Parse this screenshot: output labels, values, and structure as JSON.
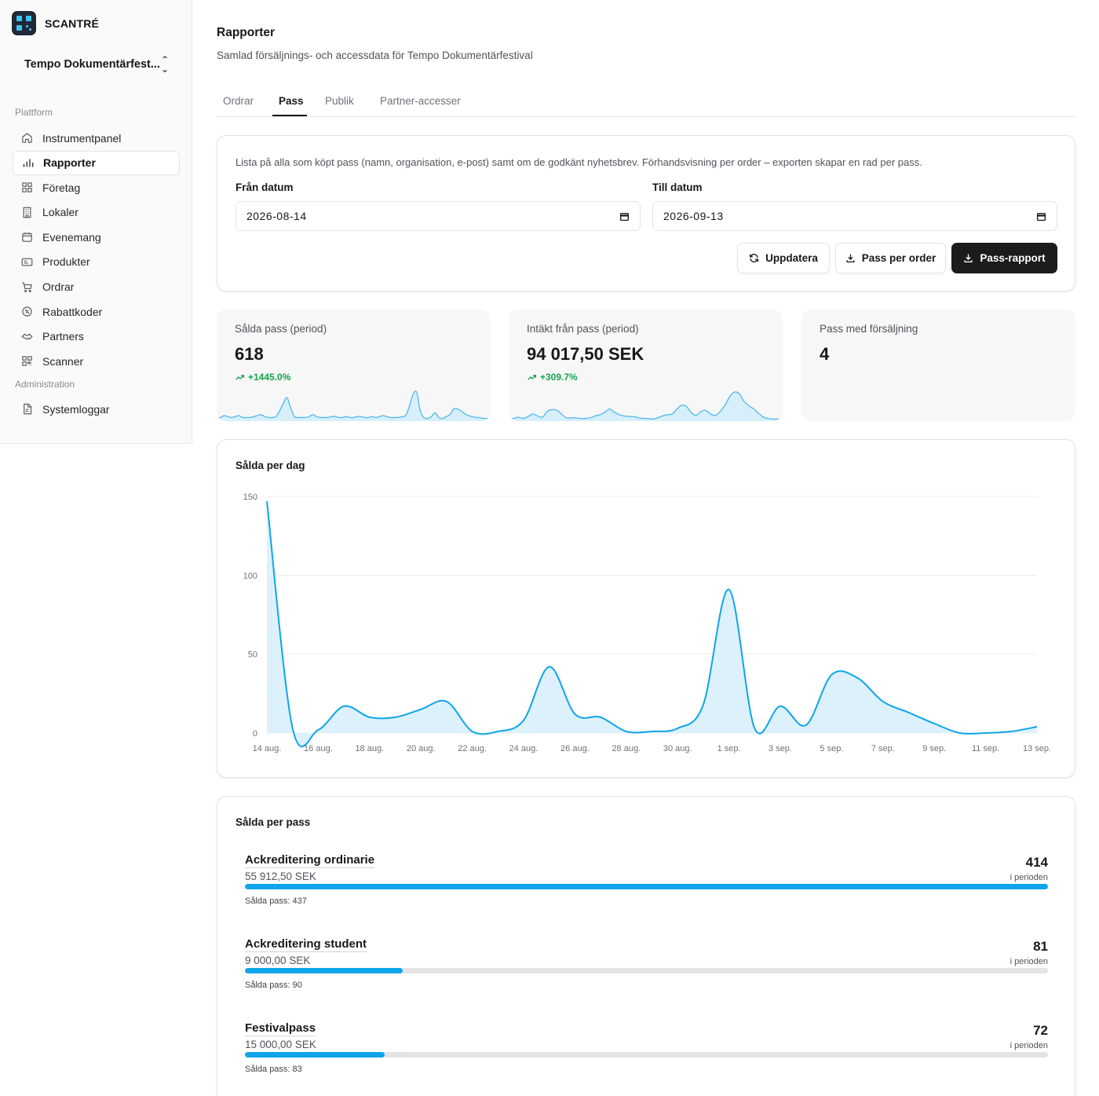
{
  "brand": {
    "name": "SCANTRÉ"
  },
  "org": {
    "name": "Tempo Dokumentärfest...",
    "chevron_icon": "chevrons-up-down-icon"
  },
  "sidebar": {
    "section_platform": "Plattform",
    "section_admin": "Administration",
    "items": [
      {
        "label": "Instrumentpanel",
        "icon": "home-icon"
      },
      {
        "label": "Rapporter",
        "icon": "bar-chart-icon",
        "active": true
      },
      {
        "label": "Företag",
        "icon": "grid-icon"
      },
      {
        "label": "Lokaler",
        "icon": "building-icon"
      },
      {
        "label": "Evenemang",
        "icon": "calendar-icon"
      },
      {
        "label": "Produkter",
        "icon": "ticket-icon"
      },
      {
        "label": "Ordrar",
        "icon": "cart-icon"
      },
      {
        "label": "Rabattkoder",
        "icon": "badge-percent-icon"
      },
      {
        "label": "Partners",
        "icon": "handshake-icon"
      },
      {
        "label": "Scanner",
        "icon": "qr-code-icon"
      }
    ],
    "admin_items": [
      {
        "label": "Systemloggar",
        "icon": "file-icon"
      }
    ]
  },
  "header": {
    "title": "Rapporter",
    "subtitle": "Samlad försäljnings- och accessdata för Tempo Dokumentärfestival"
  },
  "tabs": [
    {
      "label": "Ordrar"
    },
    {
      "label": "Pass",
      "active": true
    },
    {
      "label": "Publik"
    },
    {
      "label": "Partner-accesser"
    }
  ],
  "filters": {
    "description": "Lista på alla som köpt pass (namn, organisation, e-post) samt om de godkänt nyhetsbrev. Förhandsvisning per order – exporten skapar en rad per pass.",
    "from_label": "Från datum",
    "from_value": "2026-08-14",
    "to_label": "Till datum",
    "to_value": "2026-09-13",
    "buttons": {
      "refresh": "Uppdatera",
      "per_order": "Pass per order",
      "report": "Pass-rapport"
    }
  },
  "stats": [
    {
      "label": "Sålda pass (period)",
      "value": "618",
      "trend": "+1445.0%",
      "spark": [
        3,
        3,
        5,
        4,
        3,
        4,
        5,
        3,
        3,
        3,
        4,
        5,
        6,
        4,
        3,
        3,
        4,
        10,
        18,
        24,
        13,
        4,
        3,
        3,
        3,
        4,
        6,
        4,
        3,
        3,
        3,
        4,
        4,
        3,
        3,
        4,
        3,
        3,
        4,
        4,
        3,
        3,
        4,
        3,
        4,
        5,
        4,
        3,
        3,
        3,
        4,
        5,
        14,
        27,
        30,
        10,
        3,
        2,
        4,
        8,
        3,
        2,
        4,
        6,
        12,
        12,
        10,
        7,
        5,
        4,
        3,
        3,
        2,
        2,
        1
      ]
    },
    {
      "label": "Intäkt från pass (period)",
      "value": "94 017,50 SEK",
      "trend": "+309.7%",
      "spark": [
        2,
        3,
        5,
        3,
        6,
        10,
        7,
        5,
        14,
        17,
        16,
        10,
        4,
        4,
        4,
        3,
        3,
        4,
        7,
        9,
        13,
        18,
        13,
        9,
        7,
        6,
        6,
        4,
        3,
        3,
        2,
        4,
        7,
        9,
        10,
        18,
        24,
        22,
        12,
        8,
        14,
        16,
        10,
        8,
        14,
        24,
        38,
        45,
        42,
        30,
        23,
        18,
        11,
        5,
        3,
        2,
        2,
        1
      ]
    },
    {
      "label": "Pass med försäljning",
      "value": "4"
    }
  ],
  "chart_daily": {
    "title": "Sålda per dag"
  },
  "chart_data": {
    "type": "area",
    "title": "Sålda per dag",
    "x": [
      "14 aug.",
      "15 aug.",
      "16 aug.",
      "17 aug.",
      "18 aug.",
      "19 aug.",
      "20 aug.",
      "21 aug.",
      "22 aug.",
      "23 aug.",
      "24 aug.",
      "25 aug.",
      "26 aug.",
      "27 aug.",
      "28 aug.",
      "29 aug.",
      "30 aug.",
      "31 aug.",
      "1 sep.",
      "2 sep.",
      "3 sep.",
      "4 sep.",
      "5 sep.",
      "6 sep.",
      "7 sep.",
      "8 sep.",
      "9 sep.",
      "10 sep.",
      "11 sep.",
      "12 sep.",
      "13 sep."
    ],
    "tick_labels": [
      "14 aug.",
      "16 aug.",
      "18 aug.",
      "20 aug.",
      "22 aug.",
      "24 aug.",
      "26 aug.",
      "28 aug.",
      "30 aug.",
      "1 sep.",
      "3 sep.",
      "5 sep.",
      "7 sep.",
      "9 sep.",
      "11 sep.",
      "13 sep."
    ],
    "series": [
      {
        "values": [
          147,
          3,
          2,
          17,
          10,
          10,
          15,
          20,
          1,
          1,
          8,
          42,
          12,
          10,
          1,
          1,
          3,
          18,
          91,
          3,
          17,
          5,
          37,
          35,
          20,
          13,
          6,
          0,
          0,
          1,
          4
        ]
      }
    ],
    "ylim": [
      0,
      150
    ],
    "yticks": [
      0,
      50,
      100,
      150
    ],
    "grid": true,
    "color": "#0ea5e9"
  },
  "pass_list": {
    "title": "Sålda per pass",
    "count_sub": "i perioden",
    "items": [
      {
        "name": "Ackreditering ordinarie",
        "revenue": "55 912,50 SEK",
        "count": "414",
        "total": "Sålda pass: 437",
        "fraction": 1.0
      },
      {
        "name": "Ackreditering student",
        "revenue": "9 000,00 SEK",
        "count": "81",
        "total": "Sålda pass: 90",
        "fraction": 0.196
      },
      {
        "name": "Festivalpass",
        "revenue": "15 000,00 SEK",
        "count": "72",
        "total": "Sålda pass: 83",
        "fraction": 0.174
      }
    ]
  }
}
